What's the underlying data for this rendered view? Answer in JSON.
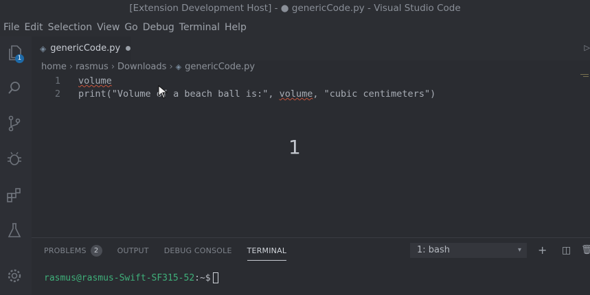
{
  "window": {
    "title": "[Extension Development Host] - ● genericCode.py - Visual Studio Code"
  },
  "menu": [
    "File",
    "Edit",
    "Selection",
    "View",
    "Go",
    "Debug",
    "Terminal",
    "Help"
  ],
  "activity": {
    "explorer_badge": "1",
    "icons": [
      "files-icon",
      "search-icon",
      "source-control-icon",
      "debug-icon",
      "extensions-icon",
      "test-flask-icon",
      "settings-gear-icon"
    ]
  },
  "editor": {
    "tab_label": "genericCode.py",
    "breadcrumb": [
      "home",
      "rasmus",
      "Downloads",
      "genericCode.py"
    ],
    "lines": [
      {
        "num": "1",
        "parts": [
          {
            "text": "volume",
            "squiggle": true
          }
        ]
      },
      {
        "num": "2",
        "parts": [
          {
            "text": "print(\"Volume of a beach ball is:\", ",
            "squiggle": false
          },
          {
            "text": "volume",
            "squiggle": true
          },
          {
            "text": ", \"cubic centimeters\")",
            "squiggle": false
          }
        ]
      }
    ],
    "overlay_number": "1"
  },
  "panel": {
    "tabs": [
      "PROBLEMS",
      "OUTPUT",
      "DEBUG CONSOLE",
      "TERMINAL"
    ],
    "problems_count": "2",
    "active_tab": "TERMINAL",
    "terminal_select": "1: bash",
    "prompt_user": "rasmus@rasmus-Swift-SF315-52",
    "prompt_path": ":~$"
  }
}
